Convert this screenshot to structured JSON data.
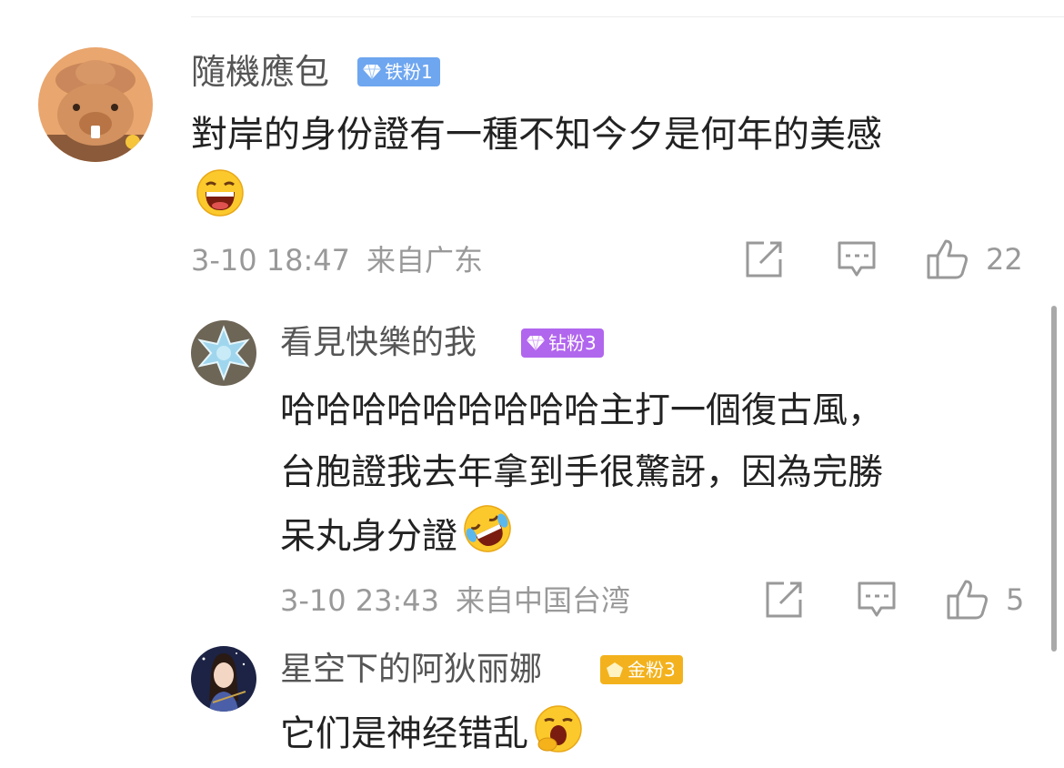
{
  "comments": [
    {
      "username": "隨機應包",
      "badge": {
        "label": "铁粉1",
        "color": "#6ea6f0"
      },
      "lines": [
        "對岸的身份證有一種不知今夕是何年的美感"
      ],
      "emoji": "grinning-face-emoji",
      "timestamp": "3-10 18:47",
      "location": "来自广东",
      "likes": "22"
    },
    {
      "username": "看見快樂的我",
      "badge": {
        "label": "钻粉3",
        "color": "#b166ee"
      },
      "lines": [
        "哈哈哈哈哈哈哈哈哈主打一個復古風，",
        "台胞證我去年拿到手很驚訝，因為完勝",
        "呆丸身分證"
      ],
      "emoji": "rolling-laughing-emoji",
      "timestamp": "3-10 23:43",
      "location": "来自中国台湾",
      "likes": "5"
    },
    {
      "username": "星空下的阿狄丽娜",
      "badge": {
        "label": "金粉3",
        "color": "#f3b21d"
      },
      "lines": [
        "它们是神经错乱"
      ],
      "emoji": "yawning-face-emoji"
    }
  ]
}
